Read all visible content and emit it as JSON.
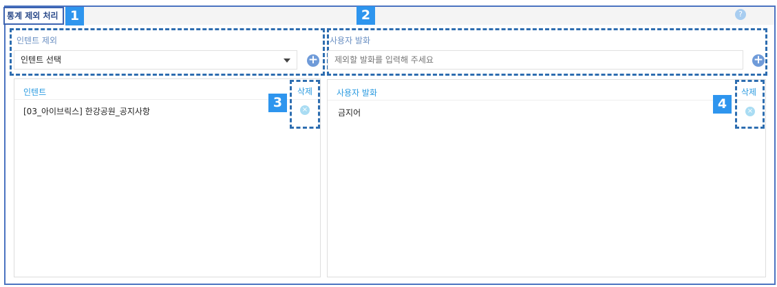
{
  "title": "통계 제외 처리",
  "badges": [
    "1",
    "2",
    "3",
    "4"
  ],
  "intent_exclude": {
    "label": "인텐트 제외",
    "select_value": "인텐트 선택"
  },
  "utterance_exclude": {
    "label": "사용자 발화",
    "placeholder": "제외할 발화를 입력해 주세요"
  },
  "intent_table": {
    "column": "인텐트",
    "delete_column": "삭제",
    "rows": [
      "[03_아이브릭스] 한강공원_공지사항"
    ]
  },
  "utterance_table": {
    "column": "사용자 발화",
    "delete_column": "삭제",
    "rows": [
      "금지어"
    ]
  },
  "icons": {
    "help": "?",
    "plus": "+",
    "delete": "×"
  },
  "colors": {
    "accent": "#2e95ee",
    "border": "#4a72c0",
    "header_text": "#2b9be0"
  }
}
